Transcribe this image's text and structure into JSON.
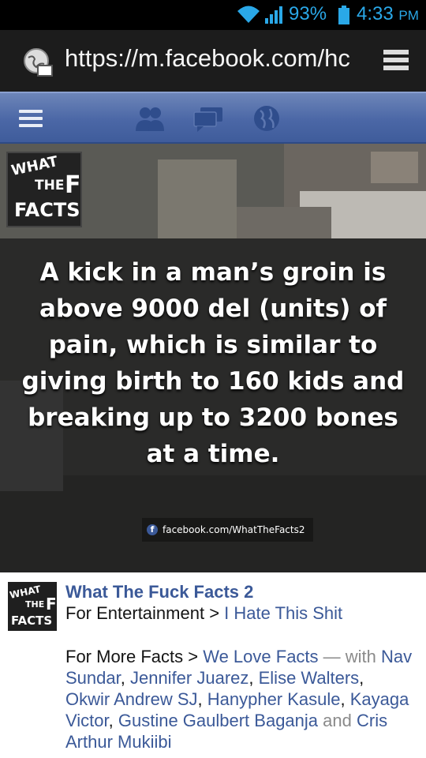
{
  "status_bar": {
    "battery_percent": "93%",
    "time": "4:33",
    "ampm": "PM",
    "accent_color": "#2aa8e8"
  },
  "address_bar": {
    "url": "https://m.facebook.com/hc",
    "icons": [
      "site-icon",
      "tabs-icon"
    ]
  },
  "fb_nav": {
    "icons": [
      "menu-icon",
      "friends-icon",
      "messages-icon",
      "globe-icon"
    ],
    "brand_color": "#3b5998"
  },
  "photo": {
    "logo": {
      "line1": "WHAT",
      "line2": "THE",
      "line3": "F",
      "line4": "FACTS"
    },
    "fact_text": "A kick in a man’s groin is above 9000 del (units) of pain, which is similar to giving birth to 160 kids and breaking up to 3200 bones at a time.",
    "fb_link": "facebook.com/WhatTheFacts2",
    "fb_icon_letter": "f"
  },
  "post": {
    "page_name": "What The Fuck Facts 2",
    "category_prefix": "For Entertainment > ",
    "category_link": "I Hate This Shit",
    "more_prefix": "For More Facts > ",
    "more_link": "We Love Facts",
    "with_text": " — with",
    "tagged_1": "Nav Sundar",
    "tagged_2": "Jennifer Juarez",
    "tagged_3": "Elise Walters",
    "tagged_4": "Okwir Andrew SJ",
    "tagged_5": "Hanypher Kasule",
    "tagged_6": "Kayaga Victor",
    "tagged_7": "Gustine Gaulbert Baganja",
    "and_text": "and",
    "tagged_8": "Cris Arthur Mukiibi"
  }
}
